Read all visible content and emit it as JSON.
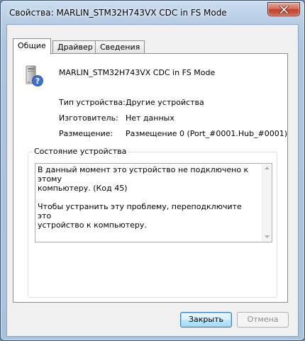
{
  "window": {
    "title": "Свойства: MARLIN_STM32H743VX CDC in FS Mode"
  },
  "tabs": [
    {
      "label": "Общие"
    },
    {
      "label": "Драйвер"
    },
    {
      "label": "Сведения"
    }
  ],
  "device": {
    "name": "MARLIN_STM32H743VX CDC in FS Mode",
    "icon": "unknown-device-icon"
  },
  "properties": [
    {
      "label": "Тип устройства:",
      "value": "Другие устройства"
    },
    {
      "label": "Изготовитель:",
      "value": "Нет данных"
    },
    {
      "label": "Размещение:",
      "value": "Размещение 0 (Port_#0001.Hub_#0001)"
    }
  ],
  "status": {
    "group_title": "Состояние устройства",
    "text": "В данный момент это устройство не подключено к этому\nкомпьютеру. (Код 45)\n\nЧтобы устранить эту проблему, переподключите это\nустройство к компьютеру."
  },
  "buttons": {
    "close_label": "Закрыть",
    "cancel_label": "Отмена"
  },
  "colors": {
    "titlebar": "#b7cde4",
    "close_button": "#c0402c",
    "default_button_border": "#3c7fb1"
  }
}
